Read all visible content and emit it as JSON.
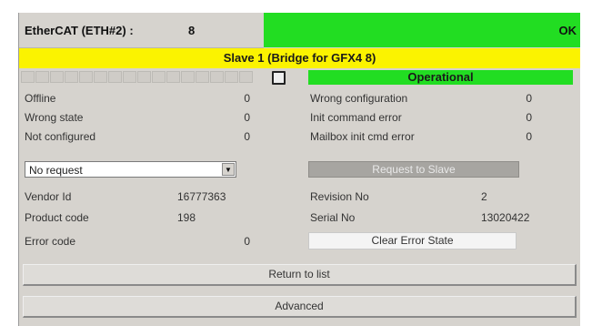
{
  "header": {
    "title": "EtherCAT (ETH#2) :",
    "number": "8",
    "state": "OK",
    "state_color": "#22dd22"
  },
  "slave": {
    "title": "Slave 1 (Bridge for GFX4 8)",
    "title_bg": "#fbf300",
    "status": "Operational",
    "status_color": "#22dd22"
  },
  "left_counters": [
    {
      "label": "Offline",
      "value": "0"
    },
    {
      "label": "Wrong state",
      "value": "0"
    },
    {
      "label": "Not configured",
      "value": "0"
    }
  ],
  "right_counters": [
    {
      "label": "Wrong configuration",
      "value": "0"
    },
    {
      "label": "Init command error",
      "value": "0"
    },
    {
      "label": "Mailbox init cmd error",
      "value": "0"
    }
  ],
  "request": {
    "selected": "No request",
    "button_label": "Request to Slave"
  },
  "info": {
    "vendor_id_label": "Vendor Id",
    "vendor_id_value": "16777363",
    "product_code_label": "Product code",
    "product_code_value": "198",
    "error_code_label": "Error code",
    "error_code_value": "0",
    "revision_label": "Revision No",
    "revision_value": "2",
    "serial_label": "Serial No",
    "serial_value": "13020422",
    "clear_button_label": "Clear Error State"
  },
  "footer": {
    "return_label": "Return to list",
    "advanced_label": "Advanced"
  }
}
